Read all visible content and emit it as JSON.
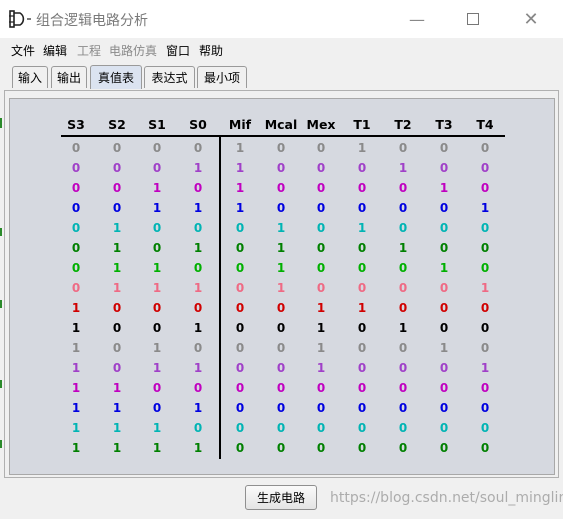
{
  "window": {
    "title": "组合逻辑电路分析"
  },
  "menu": [
    {
      "label": "文件",
      "enabled": true
    },
    {
      "label": "编辑",
      "enabled": true
    },
    {
      "label": "工程",
      "enabled": false
    },
    {
      "label": "电路仿真",
      "enabled": false
    },
    {
      "label": "窗口",
      "enabled": true
    },
    {
      "label": "帮助",
      "enabled": true
    }
  ],
  "tabs": [
    {
      "label": "输入",
      "active": false
    },
    {
      "label": "输出",
      "active": false
    },
    {
      "label": "真值表",
      "active": true
    },
    {
      "label": "表达式",
      "active": false
    },
    {
      "label": "最小项",
      "active": false
    }
  ],
  "truth_table": {
    "headers": [
      "S3",
      "S2",
      "S1",
      "S0",
      "Mif",
      "Mcal",
      "Mex",
      "T1",
      "T2",
      "T3",
      "T4"
    ],
    "rows": [
      {
        "color": "#8a8a8a",
        "values": [
          "0",
          "0",
          "0",
          "0",
          "1",
          "0",
          "0",
          "1",
          "0",
          "0",
          "0"
        ]
      },
      {
        "color": "#a040c8",
        "values": [
          "0",
          "0",
          "0",
          "1",
          "1",
          "0",
          "0",
          "0",
          "1",
          "0",
          "0"
        ]
      },
      {
        "color": "#c000c0",
        "values": [
          "0",
          "0",
          "1",
          "0",
          "1",
          "0",
          "0",
          "0",
          "0",
          "1",
          "0"
        ]
      },
      {
        "color": "#0000e0",
        "values": [
          "0",
          "0",
          "1",
          "1",
          "1",
          "0",
          "0",
          "0",
          "0",
          "0",
          "1"
        ]
      },
      {
        "color": "#00b4b4",
        "values": [
          "0",
          "1",
          "0",
          "0",
          "0",
          "1",
          "0",
          "1",
          "0",
          "0",
          "0"
        ]
      },
      {
        "color": "#008000",
        "values": [
          "0",
          "1",
          "0",
          "1",
          "0",
          "1",
          "0",
          "0",
          "1",
          "0",
          "0"
        ]
      },
      {
        "color": "#00b000",
        "values": [
          "0",
          "1",
          "1",
          "0",
          "0",
          "1",
          "0",
          "0",
          "0",
          "1",
          "0"
        ]
      },
      {
        "color": "#ef6a84",
        "values": [
          "0",
          "1",
          "1",
          "1",
          "0",
          "1",
          "0",
          "0",
          "0",
          "0",
          "1"
        ]
      },
      {
        "color": "#d00000",
        "values": [
          "1",
          "0",
          "0",
          "0",
          "0",
          "0",
          "1",
          "1",
          "0",
          "0",
          "0"
        ]
      },
      {
        "color": "#000000",
        "values": [
          "1",
          "0",
          "0",
          "1",
          "0",
          "0",
          "1",
          "0",
          "1",
          "0",
          "0"
        ]
      },
      {
        "color": "#8a8a8a",
        "values": [
          "1",
          "0",
          "1",
          "0",
          "0",
          "0",
          "1",
          "0",
          "0",
          "1",
          "0"
        ]
      },
      {
        "color": "#a040c8",
        "values": [
          "1",
          "0",
          "1",
          "1",
          "0",
          "0",
          "1",
          "0",
          "0",
          "0",
          "1"
        ]
      },
      {
        "color": "#c000c0",
        "values": [
          "1",
          "1",
          "0",
          "0",
          "0",
          "0",
          "0",
          "0",
          "0",
          "0",
          "0"
        ]
      },
      {
        "color": "#0000e0",
        "values": [
          "1",
          "1",
          "0",
          "1",
          "0",
          "0",
          "0",
          "0",
          "0",
          "0",
          "0"
        ]
      },
      {
        "color": "#00b4b4",
        "values": [
          "1",
          "1",
          "1",
          "0",
          "0",
          "0",
          "0",
          "0",
          "0",
          "0",
          "0"
        ]
      },
      {
        "color": "#008000",
        "values": [
          "1",
          "1",
          "1",
          "1",
          "0",
          "0",
          "0",
          "0",
          "0",
          "0",
          "0"
        ]
      }
    ]
  },
  "generate_button": {
    "label": "生成电路"
  },
  "watermark": "https://blog.csdn.net/soul_mingling"
}
